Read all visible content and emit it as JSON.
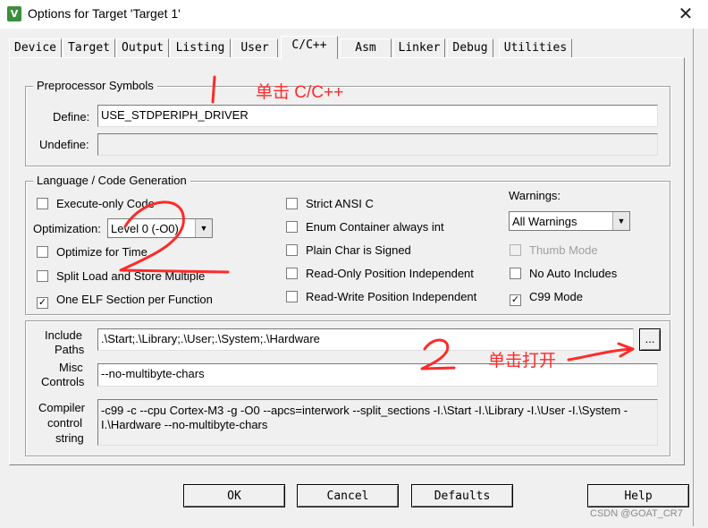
{
  "window": {
    "title": "Options for Target 'Target 1'",
    "close_glyph": "✕",
    "app_icon": "keil-uvision-icon"
  },
  "tabs": [
    {
      "label": "Device"
    },
    {
      "label": "Target"
    },
    {
      "label": "Output"
    },
    {
      "label": "Listing"
    },
    {
      "label": "User"
    },
    {
      "label": "C/C++",
      "active": true
    },
    {
      "label": "Asm"
    },
    {
      "label": "Linker"
    },
    {
      "label": "Debug"
    },
    {
      "label": "Utilities"
    }
  ],
  "preprocessor": {
    "title": "Preprocessor Symbols",
    "define_label": "Define:",
    "define_value": "USE_STDPERIPH_DRIVER",
    "undefine_label": "Undefine:",
    "undefine_value": ""
  },
  "language": {
    "title": "Language / Code Generation",
    "execute_only": {
      "label": "Execute-only Code",
      "checked": false
    },
    "optimization_label": "Optimization:",
    "optimization_value": "Level 0 (-O0)",
    "optimize_time": {
      "label": "Optimize for Time",
      "checked": false
    },
    "split_load": {
      "label": "Split Load and Store Multiple",
      "checked": false
    },
    "one_elf": {
      "label": "One ELF Section per Function",
      "checked": true,
      "mark": "✓"
    },
    "strict_ansi": {
      "label": "Strict ANSI C",
      "checked": false
    },
    "enum_int": {
      "label": "Enum Container always int",
      "checked": false
    },
    "plain_char": {
      "label": "Plain Char is Signed",
      "checked": false
    },
    "ro_pi": {
      "label": "Read-Only Position Independent",
      "checked": false
    },
    "rw_pi": {
      "label": "Read-Write Position Independent",
      "checked": false
    },
    "warnings_label": "Warnings:",
    "warnings_value": "All Warnings",
    "thumb_mode": {
      "label": "Thumb Mode",
      "checked": false,
      "disabled": true
    },
    "no_auto_includes": {
      "label": "No Auto Includes",
      "checked": false
    },
    "c99_mode": {
      "label": "C99 Mode",
      "checked": true,
      "mark": "✓"
    }
  },
  "include": {
    "include_label_1": "Include",
    "include_label_2": "Paths",
    "include_value": ".\\Start;.\\Library;.\\User;.\\System;.\\Hardware",
    "browse_label": "...",
    "misc_label_1": "Misc",
    "misc_label_2": "Controls",
    "misc_value": "--no-multibyte-chars",
    "compiler_label_1": "Compiler",
    "compiler_label_2": "control",
    "compiler_label_3": "string",
    "compiler_value": "-c99 -c --cpu Cortex-M3 -g -O0 --apcs=interwork --split_sections -I.\\Start -I.\\Library -I.\\User -I.\\System -I.\\Hardware --no-multibyte-chars"
  },
  "buttons": {
    "ok": "OK",
    "cancel": "Cancel",
    "defaults": "Defaults",
    "help": "Help"
  },
  "annotations": {
    "note1": "单击 C/C++",
    "note2": "单击打开",
    "color": "#ff2a2a"
  },
  "watermark": "CSDN @GOAT_CR7"
}
